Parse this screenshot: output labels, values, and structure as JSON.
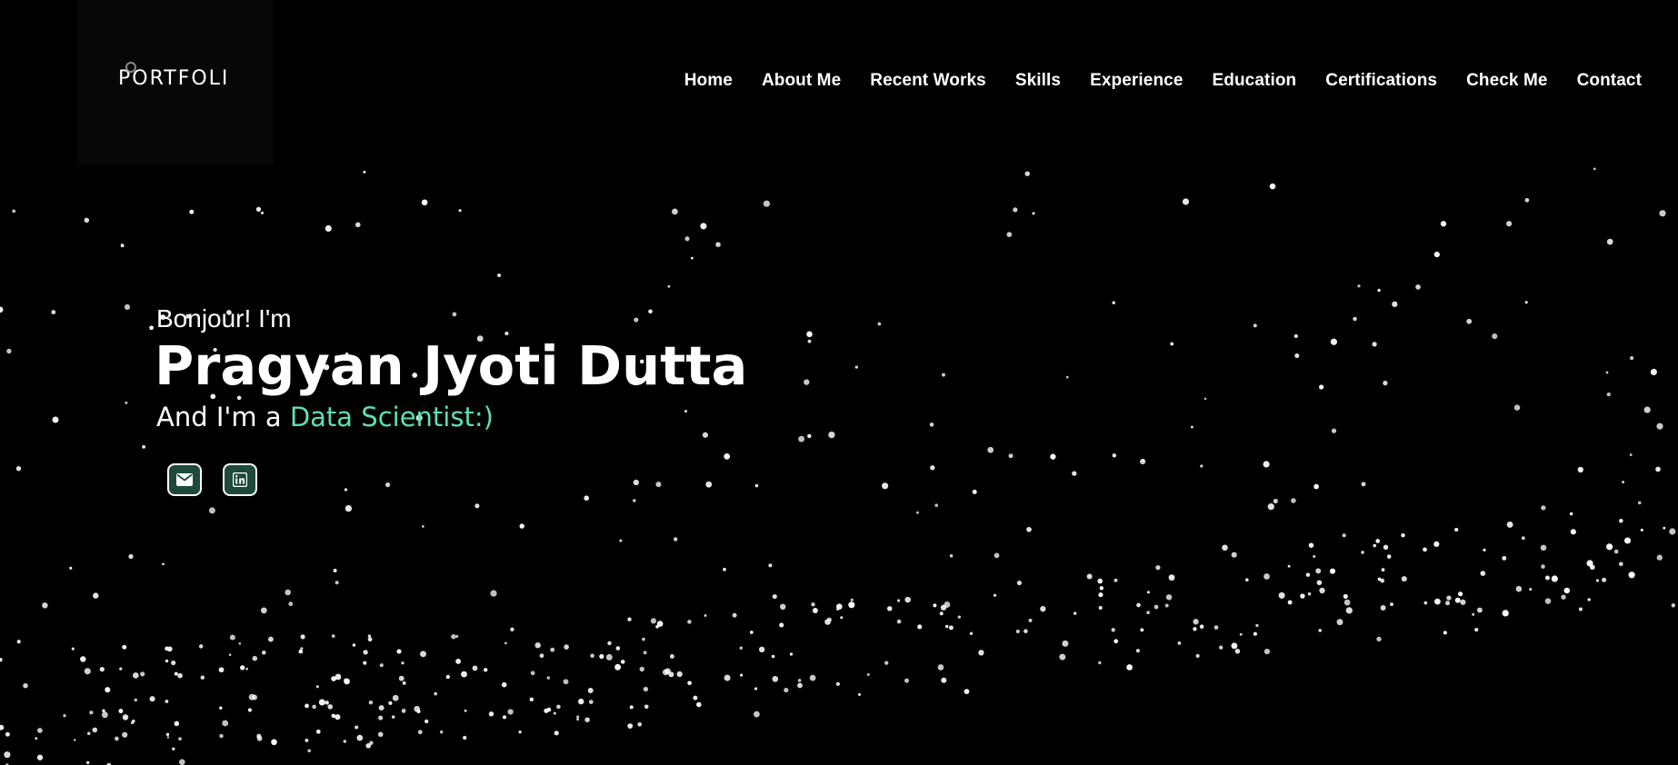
{
  "brand": {
    "logo_text": "PORTFOLI"
  },
  "nav": {
    "items": [
      {
        "label": "Home"
      },
      {
        "label": "About Me"
      },
      {
        "label": "Recent Works"
      },
      {
        "label": "Skills"
      },
      {
        "label": "Experience"
      },
      {
        "label": "Education"
      },
      {
        "label": "Certifications"
      },
      {
        "label": "Check Me"
      },
      {
        "label": "Contact"
      }
    ]
  },
  "hero": {
    "greeting": "Bonjour! I'm",
    "name": "Pragyan Jyoti Dutta",
    "role_prefix": "And I'm a ",
    "role_highlight": "Data Scientist:)"
  },
  "socials": [
    {
      "icon": "mail-icon"
    },
    {
      "icon": "linkedin-icon"
    }
  ],
  "colors": {
    "background": "#000000",
    "text": "#ffffff",
    "accent": "#5ee0b0",
    "social_button_bg": "#1d4a3b",
    "particle": "#ffffff"
  }
}
